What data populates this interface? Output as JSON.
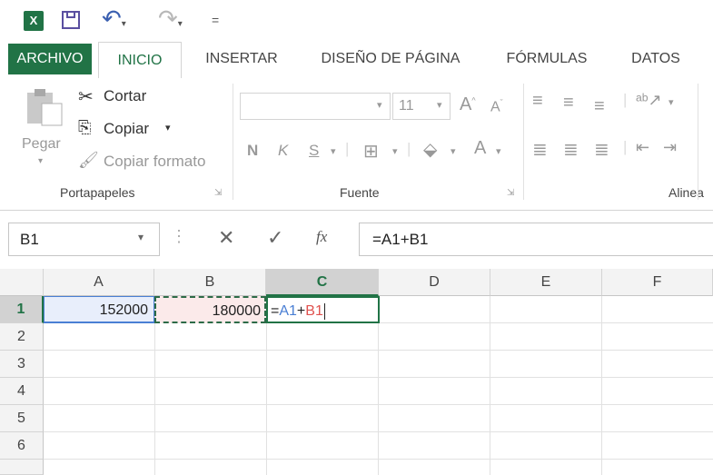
{
  "quick_access": {
    "excel_logo": "X",
    "undo_icon": "undo-icon",
    "redo_icon": "redo-icon",
    "customize": "="
  },
  "tabs": [
    {
      "label": "ARCHIVO"
    },
    {
      "label": "INICIO"
    },
    {
      "label": "INSERTAR"
    },
    {
      "label": "DISEÑO DE PÁGINA"
    },
    {
      "label": "FÓRMULAS"
    },
    {
      "label": "DATOS"
    }
  ],
  "ribbon": {
    "paste_label": "Pegar",
    "cut_label": "Cortar",
    "copy_label": "Copiar",
    "format_painter_label": "Copiar formato",
    "clipboard_group": "Portapapeles",
    "font_size": "11",
    "bold": "N",
    "italic": "K",
    "underline": "S",
    "font_group": "Fuente",
    "alignment_group": "Alinea"
  },
  "formula_bar": {
    "name_box": "B1",
    "formula": "=A1+B1",
    "fx": "fx"
  },
  "grid": {
    "columns": [
      "A",
      "B",
      "C",
      "D",
      "E",
      "F"
    ],
    "rows": [
      "1",
      "2",
      "3",
      "4",
      "5",
      "6"
    ],
    "a1": "152000",
    "b1": "180000",
    "c1_eq": "=",
    "c1_ref1": "A1",
    "c1_plus": "+",
    "c1_ref2": "B1"
  },
  "colors": {
    "accent": "#217346",
    "ref1": "#4a7fd4",
    "ref2": "#e0524f"
  }
}
